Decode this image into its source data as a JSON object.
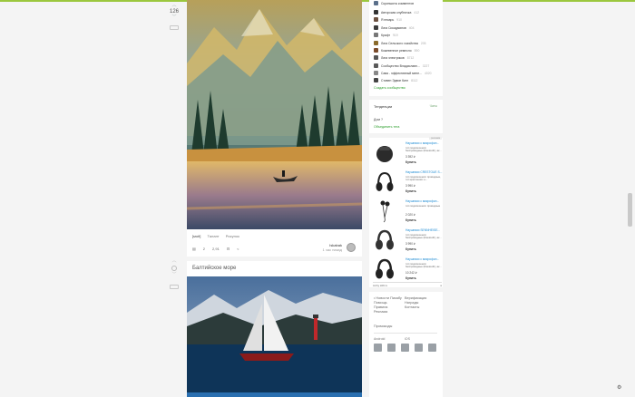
{
  "vote": {
    "count": "126"
  },
  "post1": {
    "tags": [
      "[моё]",
      "Талант",
      "Рисунок"
    ],
    "comments": "2",
    "saves": "2,91",
    "author_name": "Iskabak",
    "author_time": "1 час назад"
  },
  "post2": {
    "title": "Балтийское море"
  },
  "communities": {
    "items": [
      {
        "name": "Скриншоты комментов",
        "count": "",
        "color": "#5a6f8a"
      },
      {
        "name": "Авторская клубничка",
        "count": "412",
        "color": "#333333"
      },
      {
        "name": "Я пекарь",
        "count": "910",
        "color": "#6b5040"
      },
      {
        "name": "Лига Сисадминов",
        "count": "404",
        "color": "#3b3b3b"
      },
      {
        "name": "Крафт",
        "count": "919",
        "color": "#777777"
      },
      {
        "name": "Лига Сельского хозяйства",
        "count": "205",
        "color": "#8a6a2b"
      },
      {
        "name": "Кожевенное ремесло",
        "count": "590",
        "color": "#7a4b2b"
      },
      {
        "name": "Лига электриков",
        "count": "8712",
        "color": "#555555"
      },
      {
        "name": "Сообщество Владиславл...",
        "count": "3227",
        "color": "#5a5a5a"
      },
      {
        "name": "Сава - эффективный мене...",
        "count": "4020",
        "color": "#888888"
      },
      {
        "name": "Стивен Эдвин Кинг",
        "count": "8112",
        "color": "#444444"
      }
    ],
    "create_label": "Создать сообщество"
  },
  "trends": {
    "header": "Тенденции",
    "side_label": "Чаты",
    "item": "Дом  ?",
    "link": "Объединить тега"
  },
  "ads": {
    "tag": "реклама",
    "items": [
      {
        "title": "Наушники с микрофон...",
        "desc": "тип подключения: беспроводные (bluetooth), ак...",
        "price": "3 392 ₽",
        "buy": "Купить"
      },
      {
        "title": "Наушники CRESTOUE S...",
        "desc": "тип подключения: проводные, тип крепления: н...",
        "price": "3 990 ₽",
        "buy": "Купить"
      },
      {
        "title": "Наушники с микрофон...",
        "desc": "тип подключения: проводные",
        "price": "2 020 ₽",
        "buy": "Купить"
      },
      {
        "title": "Наушники SENNHEISE...",
        "desc": "тип подключения: беспроводные (bluetooth), ак...",
        "price": "3 990 ₽",
        "buy": "Купить"
      },
      {
        "title": "Наушники с микрофон...",
        "desc": "тип подключения: беспроводные (bluetooth), ак...",
        "price": "10 242 ₽",
        "buy": "Купить"
      }
    ],
    "footer_left": "Ad by HiFi.ru",
    "footer_right": "≡"
  },
  "footer_links": {
    "col1": [
      "• Новости Пикабу",
      "Помощь",
      "Правила",
      "Реклама"
    ],
    "col2": [
      "Верификация",
      "Награды",
      "Контакты"
    ],
    "promo": "Промокоды",
    "android": "Android",
    "ios": "iOS"
  }
}
